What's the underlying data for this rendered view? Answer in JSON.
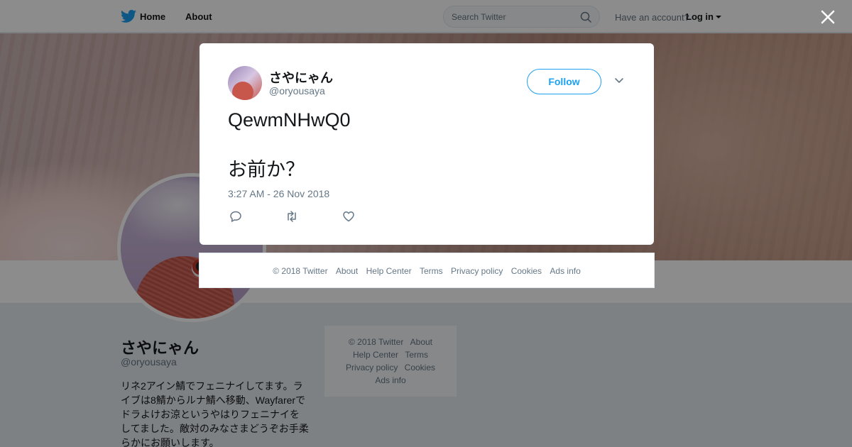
{
  "nav": {
    "home": "Home",
    "about": "About",
    "search_placeholder": "Search Twitter",
    "have_account": "Have an account?",
    "login": "Log in"
  },
  "profile": {
    "name": "さやにゃん",
    "handle": "@oryousaya",
    "bio": "リネ2アイン鯖でフェニナイしてます。ライブは8鯖からルナ鯖へ移動、Wayfarerでドラよけお涼というやはりフェニナイをしてました。敵対のみなさまどうぞお手柔らかにお願いします。"
  },
  "side_footer": {
    "row1": [
      "© 2018 Twitter",
      "About"
    ],
    "row2": [
      "Help Center",
      "Terms"
    ],
    "row3": [
      "Privacy policy",
      "Cookies"
    ],
    "row4": [
      "Ads info"
    ]
  },
  "tweet": {
    "name": "さやにゃん",
    "handle": "@oryousaya",
    "follow_label": "Follow",
    "text_line1": "QewmNHwQ0",
    "text_line2": "お前か？",
    "timestamp": "3:27 AM - 26 Nov 2018"
  },
  "modal_footer": [
    "© 2018 Twitter",
    "About",
    "Help Center",
    "Terms",
    "Privacy policy",
    "Cookies",
    "Ads info"
  ],
  "colors": {
    "twitter_blue": "#1da1f2",
    "text_primary": "#14171a",
    "text_secondary": "#657786"
  },
  "icons": [
    "twitter-bird-icon",
    "search-icon",
    "caret-down-icon",
    "close-icon",
    "chevron-down-icon",
    "reply-icon",
    "retweet-icon",
    "like-icon"
  ]
}
